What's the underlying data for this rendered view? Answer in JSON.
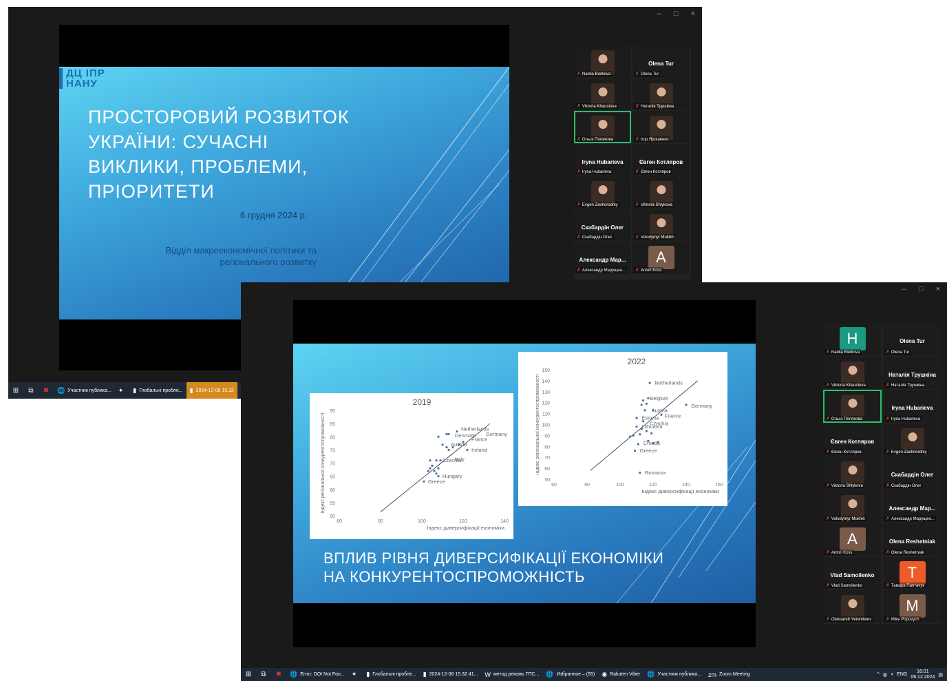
{
  "window_controls": {
    "minimize": "–",
    "maximize": "□",
    "close": "×"
  },
  "slide1": {
    "logo_line1": "ДЦ ІПР",
    "logo_line2": "НАНУ",
    "title_lines": [
      "ПРОСТОРОВИЙ РОЗВИТОК",
      "УКРАЇНИ: СУЧАСНІ",
      "ВИКЛИКИ, ПРОБЛЕМИ,",
      "ПРІОРИТЕТИ"
    ],
    "date": "6 грудня 2024 р.",
    "dept_lines": [
      "Відділ макроекономічної політики та",
      "регіонального розвитку"
    ]
  },
  "participants1": [
    {
      "type": "photo",
      "label": "Nadiia Bielkova"
    },
    {
      "type": "name",
      "name": "Olena Tur",
      "label": "Olena Tur"
    },
    {
      "type": "photo",
      "label": "Viktoria Khaustova"
    },
    {
      "type": "photo",
      "label": "Наталія Трушкіна"
    },
    {
      "type": "photo",
      "label": "Ольга Полякова",
      "active": true
    },
    {
      "type": "photo",
      "label": "Ігор Ярошенко"
    },
    {
      "type": "name",
      "name": "Iryna Hubarieva",
      "label": "Iryna Hubarieva"
    },
    {
      "type": "name",
      "name": "Євген Котляров",
      "label": "Євген Котляров"
    },
    {
      "type": "photo",
      "label": "Evgen Zavhorodniy"
    },
    {
      "type": "photo",
      "label": "Viktoria Shlykova"
    },
    {
      "type": "name",
      "name": "Скабардін Олег",
      "label": "Скабардін Олег"
    },
    {
      "type": "photo",
      "label": "Volodymyr Mukhin"
    },
    {
      "type": "name",
      "name": "Александр Мар...",
      "label": "Александр Марущен..."
    },
    {
      "type": "avatar",
      "letter": "A",
      "color": "#7a5a48",
      "label": "Anton Koss"
    }
  ],
  "participants2": [
    {
      "type": "avatar",
      "letter": "H",
      "color": "#1a9a82",
      "label": "Nadiia Bielkova"
    },
    {
      "type": "name",
      "name": "Olena Tur",
      "label": "Olena Tur"
    },
    {
      "type": "photo",
      "label": "Viktoria Khaustova"
    },
    {
      "type": "name",
      "name": "Наталія Трушкіна",
      "label": "Наталія Трушкіна"
    },
    {
      "type": "photo",
      "label": "Ольга Полякова",
      "active": true
    },
    {
      "type": "name",
      "name": "Iryna Hubarieva",
      "label": "Iryna Hubarieva"
    },
    {
      "type": "name",
      "name": "Євген Котляров",
      "label": "Євген Котляров"
    },
    {
      "type": "photo",
      "label": "Evgen Zavhorodniy"
    },
    {
      "type": "photo",
      "label": "Viktoria Shlykova"
    },
    {
      "type": "name",
      "name": "Скабардін Олег",
      "label": "Скабардін Олег"
    },
    {
      "type": "photo",
      "label": "Volodymyr Mukhin"
    },
    {
      "type": "name",
      "name": "Александр Мар...",
      "label": "Александр Марущен..."
    },
    {
      "type": "avatar",
      "letter": "A",
      "color": "#7a5a48",
      "label": "Anton Koss"
    },
    {
      "type": "name",
      "name": "Olena Reshetniak",
      "label": "Olena Reshetniak"
    },
    {
      "type": "name",
      "name": "Vlad Samoilenko",
      "label": "Vlad Samoilenko"
    },
    {
      "type": "avatar",
      "letter": "T",
      "color": "#f05a28",
      "label": "Тамара Паптачук"
    },
    {
      "type": "photo",
      "label": "Oleksandr Yeremieiev"
    },
    {
      "type": "avatar",
      "letter": "M",
      "color": "#7a5a48",
      "label": "Mike Popovych"
    }
  ],
  "slide2": {
    "title_lines": [
      "ВПЛИВ РІВНЯ ДИВЕРСИФІКАЦІЇ ЕКОНОМІКИ",
      "НА КОНКУРЕНТОСПРОМОЖНІСТЬ"
    ]
  },
  "chart_data": [
    {
      "type": "scatter",
      "title": "2019",
      "xlabel": "Індекс диверсифікації економіки",
      "ylabel": "Індекс регіональної конкурентоспроможності",
      "xlim": [
        60,
        140
      ],
      "ylim": [
        50,
        90
      ],
      "xticks": [
        60,
        80,
        100,
        120,
        140
      ],
      "yticks": [
        50,
        55,
        60,
        65,
        70,
        75,
        80,
        85,
        90
      ],
      "points": [
        {
          "x": 108,
          "y": 80
        },
        {
          "x": 112,
          "y": 81
        },
        {
          "x": 113,
          "y": 81
        },
        {
          "x": 117,
          "y": 82
        },
        {
          "x": 110,
          "y": 77
        },
        {
          "x": 112,
          "y": 76
        },
        {
          "x": 113,
          "y": 75
        },
        {
          "x": 115,
          "y": 76
        },
        {
          "x": 118,
          "y": 77
        },
        {
          "x": 120,
          "y": 78
        },
        {
          "x": 122,
          "y": 75
        },
        {
          "x": 107,
          "y": 71
        },
        {
          "x": 109,
          "y": 71
        },
        {
          "x": 104,
          "y": 71
        },
        {
          "x": 105,
          "y": 69
        },
        {
          "x": 104,
          "y": 68
        },
        {
          "x": 103,
          "y": 67
        },
        {
          "x": 106,
          "y": 67
        },
        {
          "x": 108,
          "y": 68
        },
        {
          "x": 107,
          "y": 66
        },
        {
          "x": 108,
          "y": 65
        },
        {
          "x": 101,
          "y": 63
        }
      ],
      "labels": [
        {
          "text": "Netherlands",
          "x": 119,
          "y": 83
        },
        {
          "text": "Denmark",
          "x": 116,
          "y": 80.5
        },
        {
          "text": "Germany",
          "x": 131,
          "y": 81
        },
        {
          "text": "France",
          "x": 124,
          "y": 79
        },
        {
          "text": "Austria",
          "x": 114,
          "y": 77
        },
        {
          "text": "Ireland",
          "x": 124,
          "y": 75
        },
        {
          "text": "Italy",
          "x": 116,
          "y": 71.5
        },
        {
          "text": "Czechia",
          "x": 110,
          "y": 71
        },
        {
          "text": "Hungary",
          "x": 110,
          "y": 65
        },
        {
          "text": "Greece",
          "x": 103,
          "y": 63
        }
      ],
      "trendline": [
        [
          80,
          51.5
        ],
        [
          133,
          85
        ]
      ]
    },
    {
      "type": "scatter",
      "title": "2022",
      "xlabel": "Індекс диверсифікації економіки",
      "ylabel": "Індекс регіональної конкурентоспроможності",
      "xlim": [
        60,
        160
      ],
      "ylim": [
        50,
        150
      ],
      "xticks": [
        60,
        80,
        100,
        120,
        140,
        160
      ],
      "yticks": [
        50,
        60,
        70,
        80,
        90,
        100,
        110,
        120,
        130,
        140,
        150
      ],
      "points": [
        {
          "x": 118,
          "y": 138
        },
        {
          "x": 114,
          "y": 122
        },
        {
          "x": 117,
          "y": 124
        },
        {
          "x": 116,
          "y": 119
        },
        {
          "x": 113,
          "y": 118
        },
        {
          "x": 120,
          "y": 113
        },
        {
          "x": 115,
          "y": 113
        },
        {
          "x": 125,
          "y": 109
        },
        {
          "x": 140,
          "y": 118
        },
        {
          "x": 110,
          "y": 106
        },
        {
          "x": 114,
          "y": 103
        },
        {
          "x": 110,
          "y": 98
        },
        {
          "x": 113,
          "y": 96
        },
        {
          "x": 116,
          "y": 94
        },
        {
          "x": 119,
          "y": 92
        },
        {
          "x": 112,
          "y": 91
        },
        {
          "x": 108,
          "y": 90
        },
        {
          "x": 106,
          "y": 89
        },
        {
          "x": 117,
          "y": 85
        },
        {
          "x": 123,
          "y": 84
        },
        {
          "x": 120,
          "y": 83
        },
        {
          "x": 111,
          "y": 82
        },
        {
          "x": 109,
          "y": 76
        },
        {
          "x": 112,
          "y": 56
        }
      ],
      "labels": [
        {
          "text": "Netherlands",
          "x": 121,
          "y": 138
        },
        {
          "text": "Belgium",
          "x": 118,
          "y": 124
        },
        {
          "text": "Germany",
          "x": 143,
          "y": 117
        },
        {
          "text": "Austria",
          "x": 119,
          "y": 113
        },
        {
          "text": "France",
          "x": 127,
          "y": 108
        },
        {
          "text": "Estonia",
          "x": 113,
          "y": 106
        },
        {
          "text": "Czechia",
          "x": 118,
          "y": 101
        },
        {
          "text": "Lithuania",
          "x": 113,
          "y": 98
        },
        {
          "text": "Croatia",
          "x": 114,
          "y": 83
        },
        {
          "text": "Greece",
          "x": 112,
          "y": 76
        },
        {
          "text": "Romania",
          "x": 115,
          "y": 56
        }
      ],
      "trendline": [
        [
          82,
          58
        ],
        [
          147,
          140
        ]
      ]
    }
  ],
  "taskbar1": {
    "items": [
      {
        "icon": "🌐",
        "label": "Участник публика..."
      },
      {
        "icon": "✦",
        "label": ""
      },
      {
        "icon": "▮",
        "label": "Глобальні пробле..."
      },
      {
        "icon": "▮",
        "label": "2024-12-06 15.32",
        "highlight": true
      }
    ]
  },
  "taskbar2": {
    "items": [
      {
        "icon": "🌐",
        "label": "Error: DOI Not Fou..."
      },
      {
        "icon": "✦",
        "label": ""
      },
      {
        "icon": "▮",
        "label": "Глобальні пробле..."
      },
      {
        "icon": "▮",
        "label": "2024-12-06 15.32.41..."
      },
      {
        "icon": "W",
        "label": "метод рекомь ГПС..."
      },
      {
        "icon": "🌐",
        "label": "Избранное – (55)"
      },
      {
        "icon": "◉",
        "label": "Rakuten Viber"
      },
      {
        "icon": "🌐",
        "label": "Участник публика..."
      },
      {
        "icon": "zm",
        "label": "Zoom Meeting"
      }
    ],
    "tray_lang": "ENG",
    "tray_time": "16:01",
    "tray_date": "06.12.2024"
  }
}
